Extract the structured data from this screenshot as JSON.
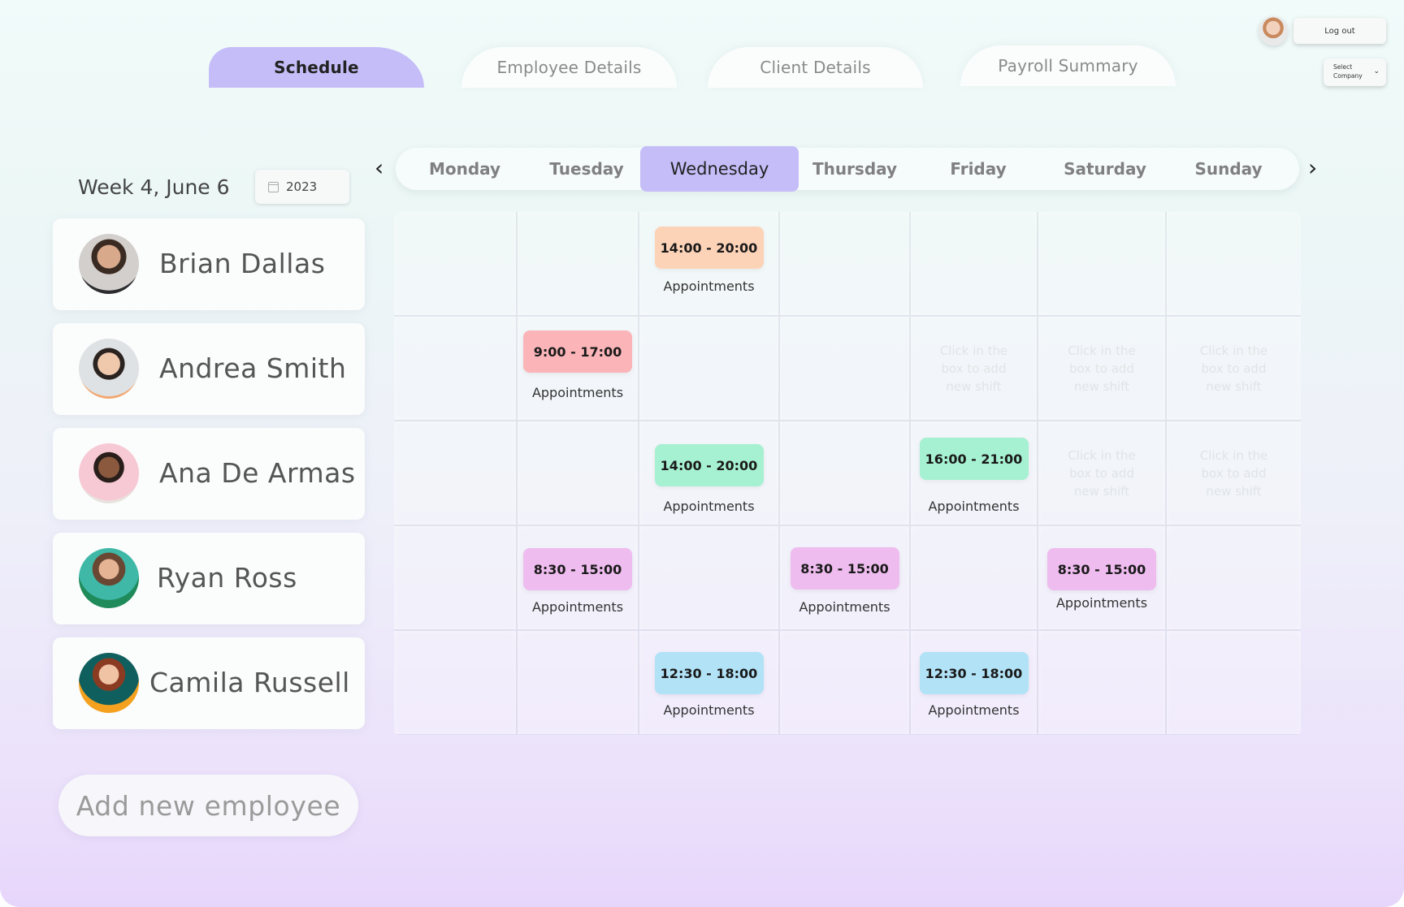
{
  "tabs": [
    {
      "label": "Schedule",
      "active": true
    },
    {
      "label": "Employee Details",
      "active": false
    },
    {
      "label": "Client Details",
      "active": false
    },
    {
      "label": "Payroll Summary",
      "active": false
    }
  ],
  "top_right": {
    "logout_label": "Log out",
    "select_company_line1": "Select",
    "select_company_line2": "Company"
  },
  "week": {
    "label": "Week 4, June 6",
    "year": "2023"
  },
  "days": [
    "Monday",
    "Tuesday",
    "Wednesday",
    "Thursday",
    "Friday",
    "Saturday",
    "Sunday"
  ],
  "active_day": "Wednesday",
  "employees": [
    {
      "name": "Brian Dallas"
    },
    {
      "name": "Andrea Smith"
    },
    {
      "name": "Ana De Armas"
    },
    {
      "name": "Ryan Ross"
    },
    {
      "name": "Camila Russell"
    }
  ],
  "add_employee_label": "Add new employee",
  "shift_label": "Appointments",
  "hint_lines": [
    "Click in the",
    "box to add",
    "new shift"
  ],
  "colors": {
    "accent": "#c5bdf8",
    "peach": "#fdd3b8",
    "pink": "#fbb5b8",
    "green": "#a6f1d2",
    "violet": "#efbcef",
    "blue": "#b1e2f6"
  },
  "shifts": [
    {
      "employee": 0,
      "day": 2,
      "time": "14:00 - 20:00",
      "color": "#fdd3b8"
    },
    {
      "employee": 1,
      "day": 1,
      "time": "9:00 - 17:00",
      "color": "#fbb5b8"
    },
    {
      "employee": 2,
      "day": 2,
      "time": "14:00 - 20:00",
      "color": "#a6f1d2"
    },
    {
      "employee": 2,
      "day": 4,
      "time": "16:00 - 21:00",
      "color": "#a6f1d2"
    },
    {
      "employee": 3,
      "day": 1,
      "time": "8:30 - 15:00",
      "color": "#efbcef"
    },
    {
      "employee": 3,
      "day": 3,
      "time": "8:30 - 15:00",
      "color": "#efbcef"
    },
    {
      "employee": 3,
      "day": 5,
      "time": "8:30 - 15:00",
      "color": "#efbcef"
    },
    {
      "employee": 4,
      "day": 2,
      "time": "12:30 - 18:00",
      "color": "#b1e2f6"
    },
    {
      "employee": 4,
      "day": 4,
      "time": "12:30 - 18:00",
      "color": "#b1e2f6"
    }
  ],
  "hints": [
    {
      "employee": 1,
      "day": 4
    },
    {
      "employee": 1,
      "day": 5
    },
    {
      "employee": 1,
      "day": 6
    },
    {
      "employee": 2,
      "day": 5
    },
    {
      "employee": 2,
      "day": 6
    }
  ]
}
